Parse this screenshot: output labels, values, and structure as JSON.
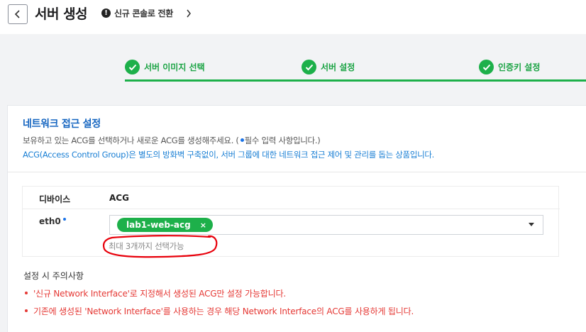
{
  "header": {
    "title": "서버 생성",
    "switch_console": "신규 콘솔로 전환"
  },
  "steps": [
    {
      "label": "서버 이미지 선택"
    },
    {
      "label": "서버 설정"
    },
    {
      "label": "인증키 설정"
    }
  ],
  "section": {
    "title": "네트워크 접근 설정",
    "desc_before": "보유하고 있는 ACG를 선택하거나 새로운 ACG를 생성해주세요. (",
    "desc_after": "필수 입력 사항입니다.)",
    "desc_acg": "ACG(Access Control Group)은 별도의 방화벽 구축없이, 서버 그룹에 대한 네트워크 접근 제어 및 관리를 돕는 상품입니다."
  },
  "table": {
    "headers": [
      "디바이스",
      "ACG"
    ],
    "row": {
      "device": "eth0",
      "selected_acg": "lab1-web-acg",
      "remove": "×",
      "hint": "최대 3개까지 선택가능"
    }
  },
  "notes": {
    "title": "설정 시 주의사항",
    "items": [
      "'신규 Network Interface'로 지정해서 생성된 ACG만 설정 가능합니다.",
      "기존에 생성된 'Network Interface'를 사용하는 경우 해당 Network Interface의 ACG를 사용하게 됩니다."
    ]
  },
  "colors": {
    "accent_green": "#1db04a",
    "title_blue": "#1565c0",
    "link_blue": "#1a7fd4",
    "warning_red": "#e53935",
    "annotation_red": "#e8000b"
  }
}
